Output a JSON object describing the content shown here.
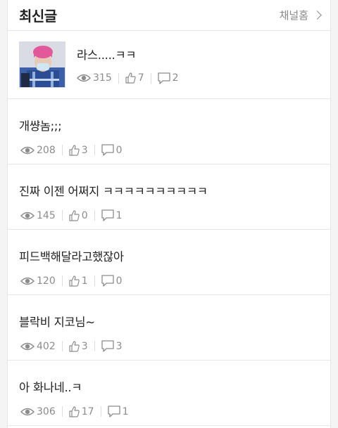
{
  "header": {
    "title": "최신글",
    "channel_home": "채널홈"
  },
  "posts": [
    {
      "title": "라스.....ㅋㅋ",
      "views": "315",
      "likes": "7",
      "comments": "2"
    },
    {
      "title": "개썅놈;;;",
      "views": "208",
      "likes": "3",
      "comments": "0"
    },
    {
      "title": "진짜 이젠 어쩌지 ㅋㅋㅋㅋㅋㅋㅋㅋㅋㅋ",
      "views": "145",
      "likes": "0",
      "comments": "1"
    },
    {
      "title": "피드백해달라고했잖아",
      "views": "120",
      "likes": "1",
      "comments": "0"
    },
    {
      "title": "블락비 지코님~",
      "views": "402",
      "likes": "3",
      "comments": "3"
    },
    {
      "title": "아 화나네..ㅋ",
      "views": "306",
      "likes": "17",
      "comments": "1"
    }
  ]
}
